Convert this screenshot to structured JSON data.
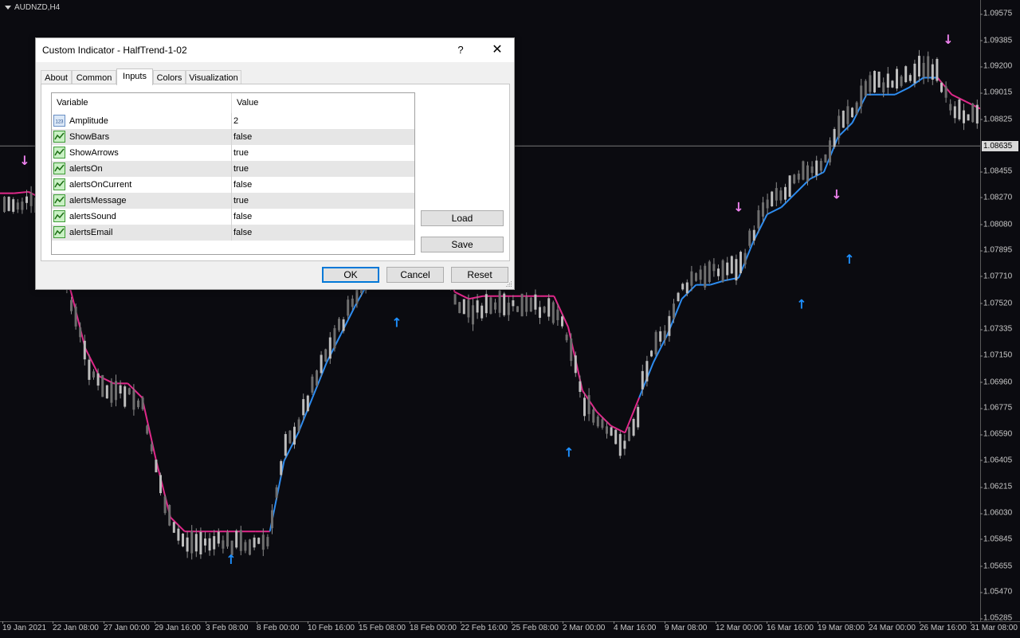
{
  "chart": {
    "symbol": "AUDNZD,H4",
    "current_price": "1.08635",
    "price_ticks": [
      "1.09575",
      "1.09385",
      "1.09200",
      "1.09015",
      "1.08825",
      "1.08455",
      "1.08270",
      "1.08080",
      "1.07895",
      "1.07710",
      "1.07520",
      "1.07335",
      "1.07150",
      "1.06960",
      "1.06775",
      "1.06590",
      "1.06405",
      "1.06215",
      "1.06030",
      "1.05845",
      "1.05655",
      "1.05470",
      "1.05285"
    ],
    "time_ticks": [
      "19 Jan 2021",
      "22 Jan 08:00",
      "27 Jan 00:00",
      "29 Jan 16:00",
      "3 Feb 08:00",
      "8 Feb 00:00",
      "10 Feb 16:00",
      "15 Feb 08:00",
      "18 Feb 00:00",
      "22 Feb 16:00",
      "25 Feb 08:00",
      "2 Mar 00:00",
      "4 Mar 16:00",
      "9 Mar 08:00",
      "12 Mar 00:00",
      "16 Mar 16:00",
      "19 Mar 08:00",
      "24 Mar 00:00",
      "26 Mar 16:00",
      "31 Mar 08:00"
    ],
    "colors": {
      "bull": "#2d8cf0",
      "bear": "#e0288a",
      "down_arrow": "#ee82ee",
      "up_arrow": "#1e90ff",
      "candle": "#8c8c8c"
    },
    "halftrend_levels": [
      1.083,
      1.083,
      1.0831,
      1.0826,
      1.079,
      1.076,
      1.072,
      1.07,
      1.0695,
      1.0695,
      1.0685,
      1.064,
      1.06,
      1.059,
      1.059,
      1.059,
      1.059,
      1.059,
      1.059,
      1.059,
      1.064,
      1.066,
      1.0685,
      1.071,
      1.073,
      1.075,
      1.0768,
      1.078,
      1.079,
      1.08,
      1.082,
      1.08,
      1.076,
      1.0755,
      1.0757,
      1.0757,
      1.0757,
      1.0757,
      1.0757,
      1.0757,
      1.0735,
      1.069,
      1.0675,
      1.0665,
      1.066,
      1.0685,
      1.071,
      1.073,
      1.0755,
      1.0765,
      1.0765,
      1.0768,
      1.077,
      1.0795,
      1.0815,
      1.082,
      1.083,
      1.084,
      1.0845,
      1.087,
      1.088,
      1.09,
      1.09,
      1.09,
      1.0905,
      1.0912,
      1.0912,
      1.09,
      1.0895,
      1.089
    ],
    "arrows": [
      {
        "dir": "down",
        "label": "↓"
      },
      {
        "dir": "up",
        "label": "↑"
      },
      {
        "dir": "up",
        "label": "↑"
      },
      {
        "dir": "up",
        "label": "↑"
      },
      {
        "dir": "down",
        "label": "↓"
      },
      {
        "dir": "up",
        "label": "↑"
      },
      {
        "dir": "down",
        "label": "↓"
      },
      {
        "dir": "up",
        "label": "↑"
      },
      {
        "dir": "down",
        "label": "↓"
      }
    ]
  },
  "dialog": {
    "title": "Custom Indicator - HalfTrend-1-02",
    "help_label": "?",
    "close_label": "✕",
    "tabs": [
      "About",
      "Common",
      "Inputs",
      "Colors",
      "Visualization"
    ],
    "active_tab": "Inputs",
    "grid": {
      "col_variable": "Variable",
      "col_value": "Value",
      "rows": [
        {
          "name": "Amplitude",
          "value": "2",
          "icon": "int-icon"
        },
        {
          "name": "ShowBars",
          "value": "false",
          "icon": "bool-icon"
        },
        {
          "name": "ShowArrows",
          "value": "true",
          "icon": "bool-icon"
        },
        {
          "name": "alertsOn",
          "value": "true",
          "icon": "bool-icon"
        },
        {
          "name": "alertsOnCurrent",
          "value": "false",
          "icon": "bool-icon"
        },
        {
          "name": "alertsMessage",
          "value": "true",
          "icon": "bool-icon"
        },
        {
          "name": "alertsSound",
          "value": "false",
          "icon": "bool-icon"
        },
        {
          "name": "alertsEmail",
          "value": "false",
          "icon": "bool-icon"
        }
      ]
    },
    "load_label": "Load",
    "save_label": "Save",
    "ok_label": "OK",
    "cancel_label": "Cancel",
    "reset_label": "Reset"
  }
}
